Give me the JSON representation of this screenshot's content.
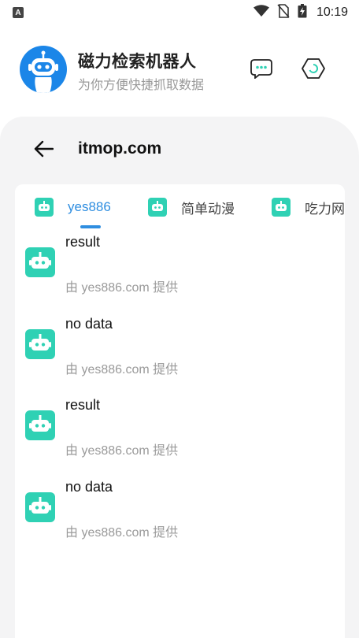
{
  "status_bar": {
    "time": "10:19",
    "left_icon": "A",
    "icons": [
      "wifi-icon",
      "no-sim-icon",
      "battery-charging-icon"
    ]
  },
  "header": {
    "title": "磁力检索机器人",
    "subtitle": "为你方便快捷抓取数据",
    "actions": [
      "chat-bubble-icon",
      "settings-hexagon-icon"
    ]
  },
  "page": {
    "title": "itmop.com"
  },
  "tabs": [
    {
      "label": "yes886",
      "active": true
    },
    {
      "label": "简单动漫",
      "active": false
    },
    {
      "label": "吃力网",
      "active": false
    }
  ],
  "results": [
    {
      "title": "result",
      "source": "由 yes886.com 提供"
    },
    {
      "title": "no data",
      "source": "由 yes886.com 提供"
    },
    {
      "title": "result",
      "source": "由 yes886.com 提供"
    },
    {
      "title": "no data",
      "source": "由 yes886.com 提供"
    }
  ],
  "colors": {
    "accent": "#2f8ee0",
    "avatar_bg": "#1b86e8",
    "bot_icon": "#2fd1b4",
    "panel_bg": "#f4f4f5"
  }
}
